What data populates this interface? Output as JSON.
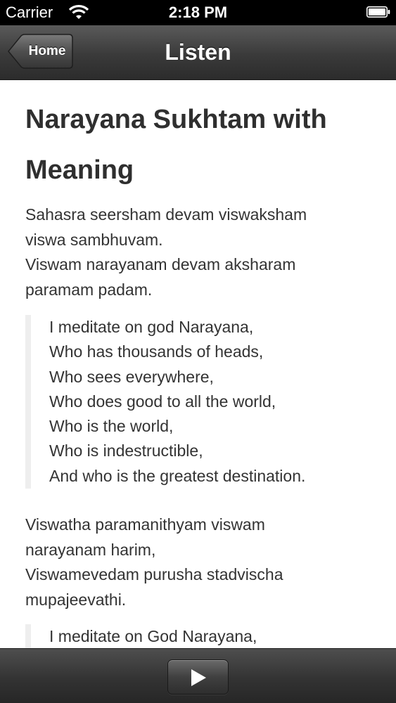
{
  "status_bar": {
    "carrier": "Carrier",
    "time": "2:18 PM"
  },
  "nav": {
    "back_label": "Home",
    "title": "Listen"
  },
  "content": {
    "title": "Narayana Sukhtam with Meaning",
    "sections": [
      {
        "verse": [
          "Sahasra seersham devam viswaksham",
          "viswa sambhuvam.",
          "Viswam narayanam devam aksharam",
          "paramam padam."
        ],
        "meaning": [
          "I meditate on god Narayana,",
          "Who has thousands of heads,",
          "Who sees everywhere,",
          "Who does good to all the world,",
          "Who is the world,",
          "Who is indestructible,",
          "And who is the greatest destination."
        ]
      },
      {
        "verse": [
          "Viswatha paramanithyam viswam",
          "narayanam harim,",
          "Viswamevedam purusha stadvischa",
          "mupajeevathi."
        ],
        "meaning": [
          "I meditate on God Narayana,"
        ]
      }
    ]
  },
  "toolbar": {
    "play_icon": "play-icon"
  },
  "colors": {
    "nav_bar": "#3a3a3a",
    "status_bar": "#000000",
    "text": "#333333",
    "blockquote_border": "#eeeeee"
  }
}
